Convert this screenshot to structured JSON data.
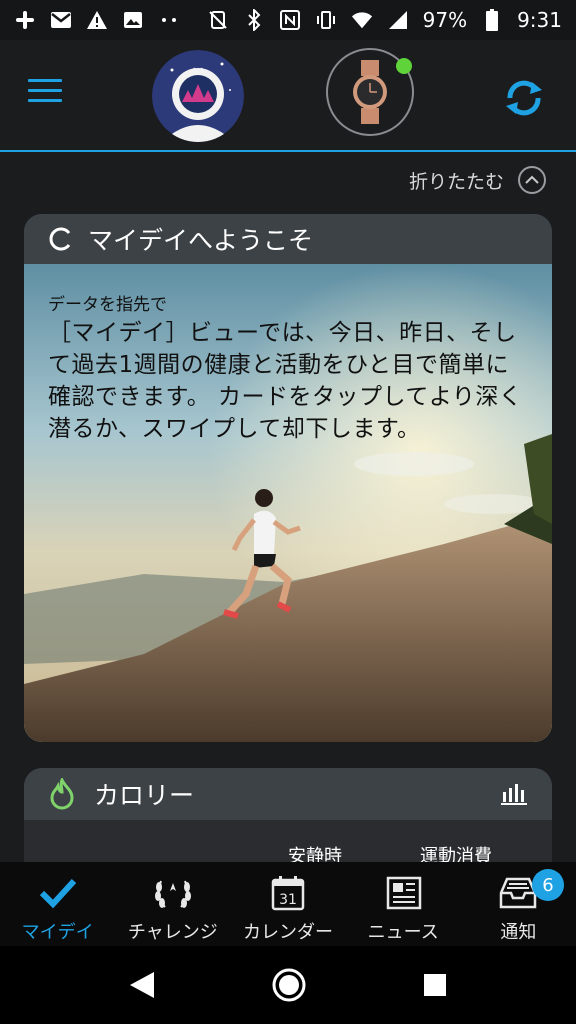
{
  "status_bar": {
    "battery": "97%",
    "time": "9:31"
  },
  "header": {
    "collapse_label": "折りたたむ"
  },
  "welcome_card": {
    "title": "マイデイへようこそ",
    "subtitle": "データを指先で",
    "body": "［マイデイ］ビューでは、今日、昨日、そして過去1週間の健康と活動をひと目で簡単に確認できます。 カードをタップしてより深く潜るか、スワイプして却下します。"
  },
  "calorie_card": {
    "title": "カロリー",
    "col_rest": "安静時",
    "col_active": "運動消費"
  },
  "bottom_nav": {
    "items": [
      {
        "label": "マイデイ",
        "icon": "check-icon"
      },
      {
        "label": "チャレンジ",
        "icon": "laurel-icon"
      },
      {
        "label": "カレンダー",
        "icon": "calendar-icon",
        "day": "31"
      },
      {
        "label": "ニュース",
        "icon": "newspaper-icon"
      },
      {
        "label": "通知",
        "icon": "inbox-icon",
        "badge": "6"
      }
    ]
  },
  "colors": {
    "accent": "#1fa2e3",
    "background": "#1b1c1e",
    "calorie_green": "#7fd36a",
    "device_connected": "#5fd33a"
  }
}
